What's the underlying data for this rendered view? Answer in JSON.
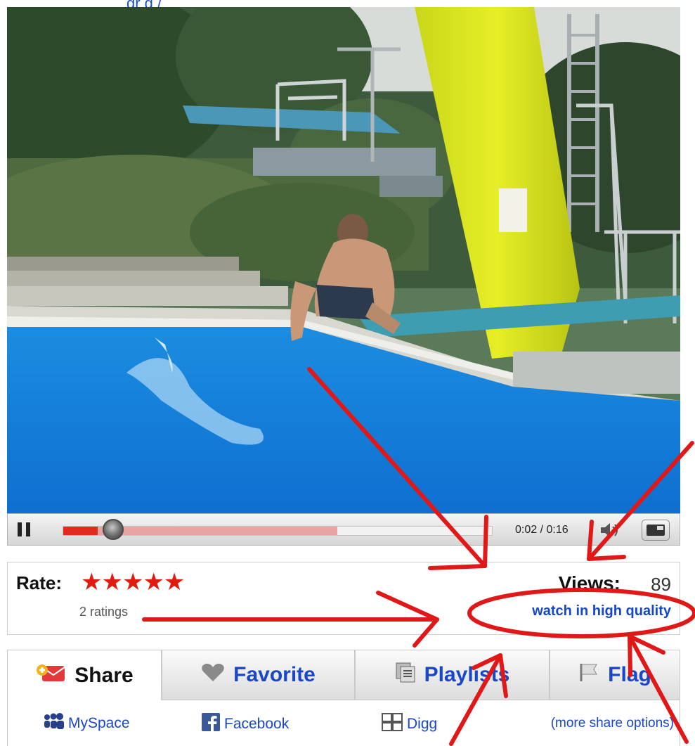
{
  "header": {
    "top_link": "gr g /"
  },
  "player": {
    "time": "0:02 / 0:16",
    "progress_fraction": 0.08,
    "loaded_fraction": 0.64
  },
  "rating": {
    "label": "Rate:",
    "stars": "★★★★★",
    "count_text": "2 ratings",
    "views_label": "Views:",
    "views_value": "89",
    "hq_link": "watch in high quality"
  },
  "tabs": [
    {
      "label": "Share"
    },
    {
      "label": "Favorite"
    },
    {
      "label": "Playlists"
    },
    {
      "label": "Flag"
    }
  ],
  "share_links": [
    {
      "label": "MySpace"
    },
    {
      "label": "Facebook"
    },
    {
      "label": "Digg"
    }
  ],
  "more_share": "(more share options)",
  "colors": {
    "accent_red": "#e12b1f",
    "link_blue": "#1a47c8",
    "annotation_red": "#e01818"
  }
}
